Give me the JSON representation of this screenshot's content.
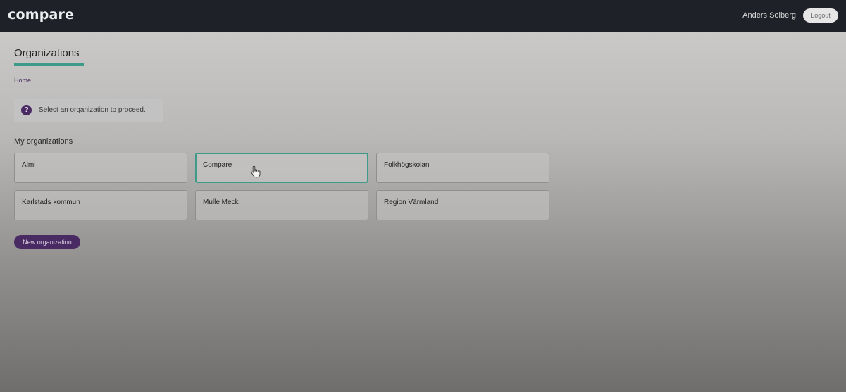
{
  "header": {
    "logo": "compare",
    "user_name": "Anders Solberg",
    "logout_label": "Logout"
  },
  "page": {
    "title": "Organizations",
    "breadcrumb": "Home",
    "info_icon_glyph": "?",
    "info_text": "Select an organization to proceed.",
    "section_title": "My organizations",
    "new_org_label": "New organization"
  },
  "organizations": [
    {
      "name": "Almi"
    },
    {
      "name": "Compare"
    },
    {
      "name": "Folkhögskolan"
    },
    {
      "name": "Karlstads kommun"
    },
    {
      "name": "Mulle Meck"
    },
    {
      "name": "Region Värmland"
    }
  ],
  "icons": {
    "info": "question-circle-icon",
    "cursor": "hand-pointer-icon"
  },
  "colors": {
    "topbar": "#1f2128",
    "accent_teal": "#3e9b8a",
    "brand_purple": "#4a2a63"
  }
}
